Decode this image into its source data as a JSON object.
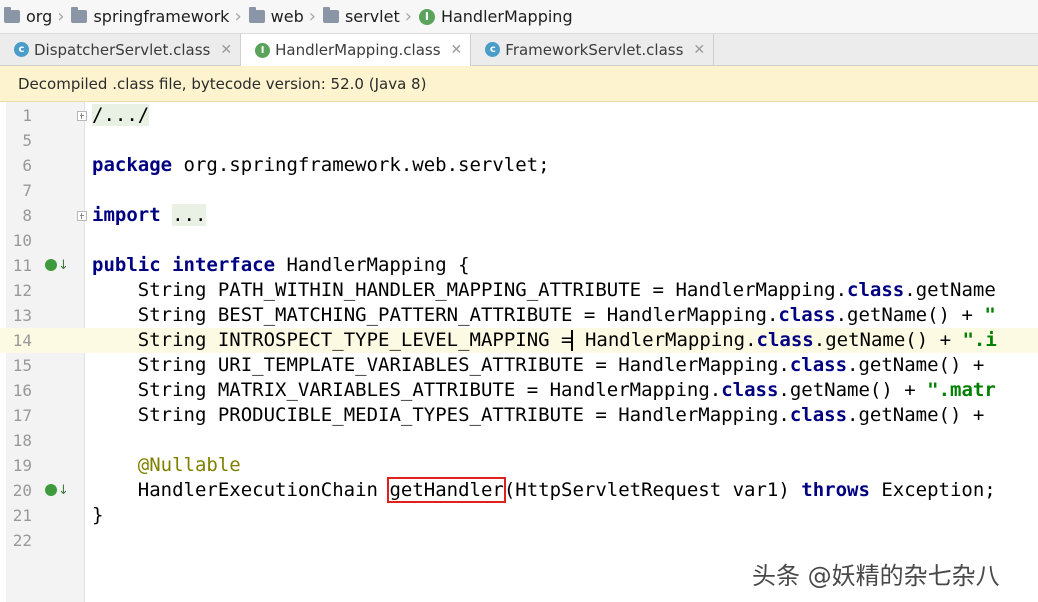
{
  "breadcrumb": [
    "org",
    "springframework",
    "web",
    "servlet",
    "HandlerMapping"
  ],
  "breadcrumb_icons": [
    "folder-icon",
    "folder-icon",
    "folder-icon",
    "folder-icon",
    "interface-icon"
  ],
  "icon_letters": {
    "class": "c",
    "interface": "I"
  },
  "tabs": [
    {
      "label": "DispatcherServlet.class",
      "icon": "class-icon",
      "active": false
    },
    {
      "label": "HandlerMapping.class",
      "icon": "interface-icon",
      "active": true
    },
    {
      "label": "FrameworkServlet.class",
      "icon": "class-icon",
      "active": false
    }
  ],
  "tab_close": "✕",
  "notice": "Decompiled .class file, bytecode version: 52.0 (Java 8)",
  "lines": [
    "1",
    "5",
    "6",
    "7",
    "8",
    "10",
    "11",
    "12",
    "13",
    "14",
    "15",
    "16",
    "17",
    "18",
    "19",
    "20",
    "21",
    "22"
  ],
  "code": {
    "l1": "/.../",
    "kw_package": "package",
    "pkg": " org.springframework.web.servlet;",
    "kw_import": "import",
    "import_rest": "...",
    "kw_public": "public",
    "kw_interface": "interface",
    "iface_name": " HandlerMapping {",
    "type_string": "String",
    "handler_mapping": "HandlerMapping",
    "kw_class": "class",
    "f1": "PATH_WITHIN_HANDLER_MAPPING_ATTRIBUTE",
    "f1_rest": ".getName",
    "f2": "BEST_MATCHING_PATTERN_ATTRIBUTE",
    "f2_rest": ".getName() + ",
    "f2_str": "\"",
    "f3": "INTROSPECT_TYPE_LEVEL_MAPPING",
    "f3_rest": ".getName() + ",
    "f3_str": "\".i",
    "f4": "URI_TEMPLATE_VARIABLES_ATTRIBUTE",
    "f4_rest": ".getName() +",
    "f5": "MATRIX_VARIABLES_ATTRIBUTE",
    "f5_rest": ".getName() + ",
    "f5_str": "\".matr",
    "f6": "PRODUCIBLE_MEDIA_TYPES_ATTRIBUTE",
    "f6_rest": ".getName() +",
    "annotation": "@Nullable",
    "ret_type": "HandlerExecutionChain",
    "method": "getHandler",
    "params": "(HttpServletRequest var1) ",
    "kw_throws": "throws",
    "exception": " Exception;",
    "close_brace": "}"
  },
  "watermark": "头条 @妖精的杂七杂八"
}
